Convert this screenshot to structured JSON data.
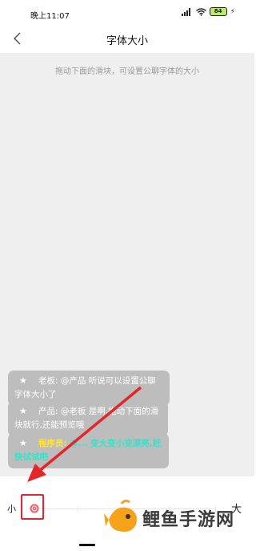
{
  "status_bar": {
    "time": "晚上11:07",
    "battery": "84"
  },
  "nav": {
    "title": "字体大小"
  },
  "preview": {
    "hint": "拖动下面的滑块，可设置公聊字体的大小",
    "messages": [
      {
        "sender": "老板:",
        "text": "@产品 听说可以设置公聊字体大小了"
      },
      {
        "sender": "产品:",
        "text": "@老板 是啊,拖动下面的滑块就行,还能预览哦"
      },
      {
        "sender": "程序员:",
        "text": "@... 变大变小变漂亮,赶快试试吧"
      }
    ]
  },
  "slider": {
    "label_small": "小",
    "label_large": "大",
    "value": 0,
    "min_label": "小",
    "max_label": "大"
  },
  "watermark": {
    "text": "鲤鱼手游网"
  },
  "colors": {
    "highlight": "#e3262a",
    "bubble": "#bdbdbd",
    "accent_yellow": "#ffe23a",
    "accent_cyan": "#39e0c8"
  }
}
